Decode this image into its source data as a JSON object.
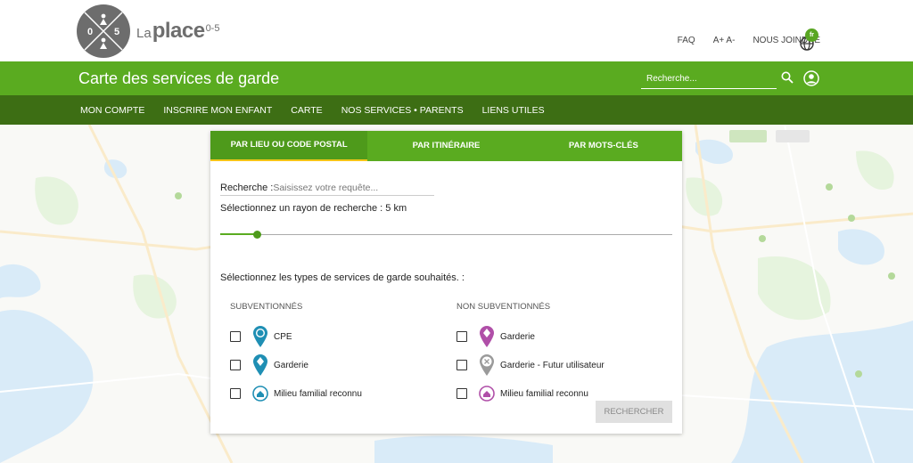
{
  "header": {
    "logo_digits": [
      "0",
      "5"
    ],
    "logo_la": "La",
    "logo_place": "place",
    "logo_age": "0-5",
    "links": [
      "FAQ",
      "A+ A-",
      "NOUS JOINDRE"
    ],
    "lang_badge": "fr"
  },
  "titlebar": {
    "title": "Carte des services de garde",
    "search_placeholder": "Recherche..."
  },
  "nav": {
    "items": [
      "MON COMPTE",
      "INSCRIRE MON ENFANT",
      "CARTE",
      "NOS SERVICES • PARENTS",
      "LIENS UTILES"
    ]
  },
  "panel": {
    "tabs": [
      "PAR LIEU OU CODE POSTAL",
      "PAR ITINÉRAIRE",
      "PAR MOTS-CLÉS"
    ],
    "active_tab": 0,
    "search_label": "Recherche :",
    "search_placeholder": "Saisissez votre requête...",
    "radius_label": "Sélectionnez un rayon de recherche : 5 km",
    "radius_slider_fraction": 0.08,
    "types_label": "Sélectionnez les types de services de garde souhaités. :",
    "subsidized": {
      "heading": "SUBVENTIONNÉS",
      "options": [
        {
          "label": "CPE",
          "icon": "cpe-pin-icon",
          "color": "#1f8fb4"
        },
        {
          "label": "Garderie",
          "icon": "garderie-pin-icon",
          "color": "#1f8fb4"
        },
        {
          "label": "Milieu familial reconnu",
          "icon": "home-circle-icon",
          "color": "#1f8fb4"
        }
      ]
    },
    "non_subsidized": {
      "heading": "NON SUBVENTIONNÉS",
      "options": [
        {
          "label": "Garderie",
          "icon": "garderie-pin-icon",
          "color": "#b04fa8"
        },
        {
          "label": "Garderie - Futur utilisateur",
          "icon": "future-user-pin-icon",
          "color": "#9a9a9a"
        },
        {
          "label": "Milieu familial reconnu",
          "icon": "home-circle-icon",
          "color": "#b04fa8"
        }
      ]
    },
    "button": "RECHERCHER"
  },
  "colors": {
    "green": "#5aab20",
    "dark_green": "#3d6e14",
    "tab_underline": "#f5c518"
  }
}
